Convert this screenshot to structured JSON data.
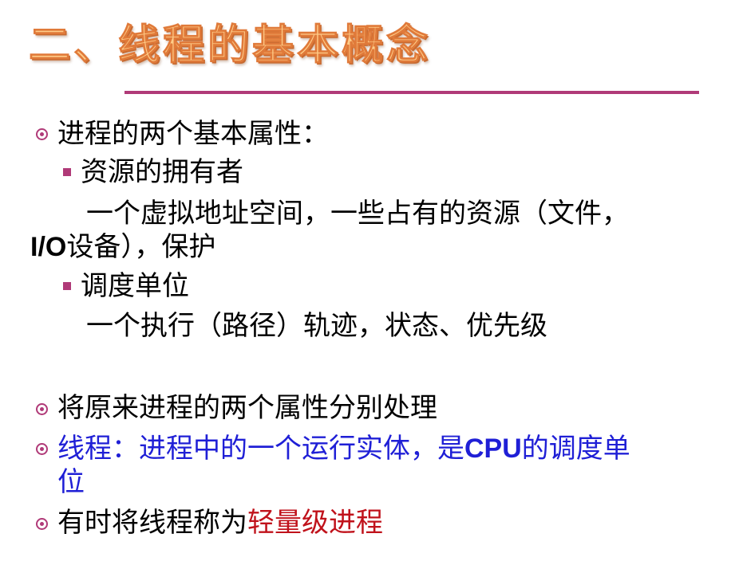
{
  "title": "二、线程的基本概念",
  "colors": {
    "title_fill": "#ffcc88",
    "title_outline": "#e07a3a",
    "accent": "#b03a78",
    "blue_text": "#1f1fd6",
    "red_text": "#c0121b"
  },
  "icons": {
    "level1_bullet": "target-circle-icon",
    "level2_bullet": "square-bullet-icon"
  },
  "content": {
    "b1": "进程的两个基本属性：",
    "b1_sub1": "资源的拥有者",
    "b1_sub1_detail_line1": "一个虚拟地址空间，一些占有的资源（文件，",
    "b1_sub1_detail_line2_latin": "I/O",
    "b1_sub1_detail_line2_rest": "设备），保护",
    "b1_sub2": "调度单位",
    "b1_sub2_detail": "一个执行（路径）轨迹，状态、优先级",
    "b2": "将原来进程的两个属性分别处理",
    "b3_part1": "线程：进程中的一个运行实体，是",
    "b3_latin": "CPU",
    "b3_part2": "的调度单",
    "b3_line2": "位",
    "b4_prefix": "有时将线程称为",
    "b4_highlight": "轻量级进程"
  }
}
